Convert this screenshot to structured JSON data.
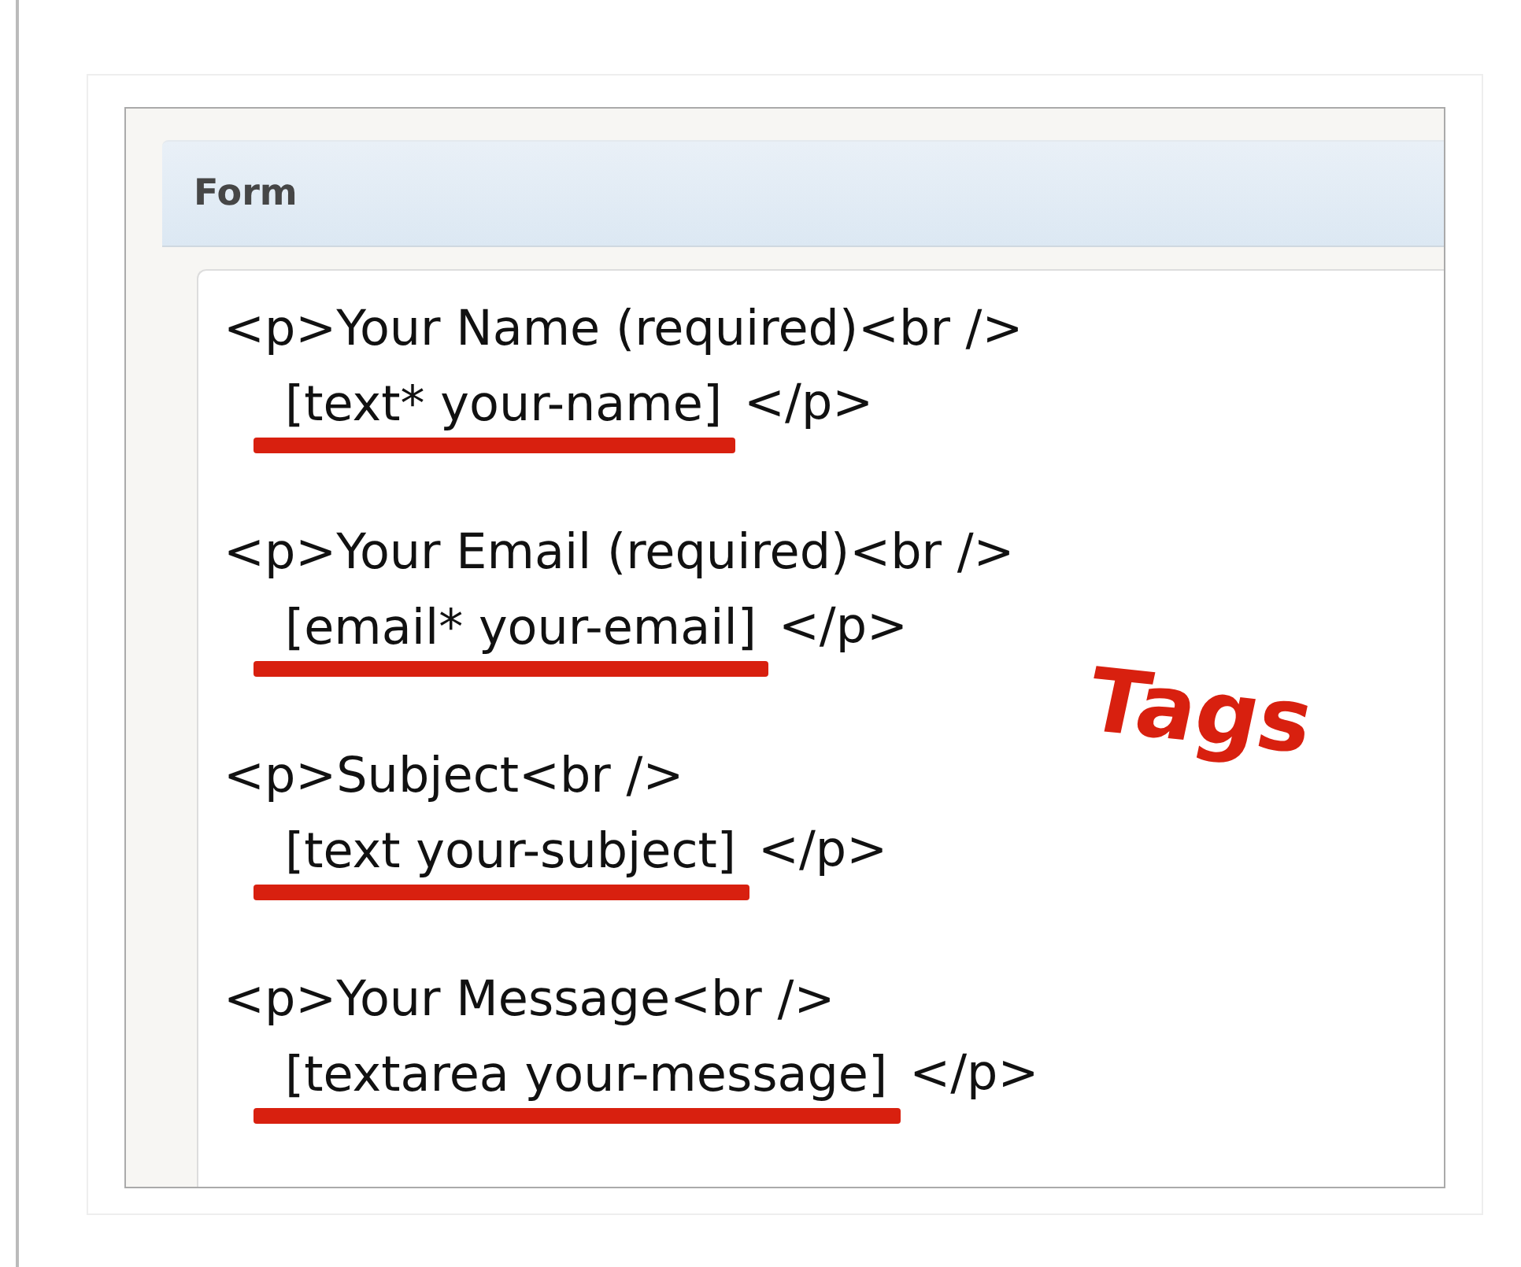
{
  "panel": {
    "title": "Form"
  },
  "blocks": [
    {
      "line": "<p>Your Name (required)<br />",
      "tag": "[text* your-name]",
      "close": "</p>"
    },
    {
      "line": "<p>Your Email (required)<br />",
      "tag": "[email* your-email]",
      "close": "</p>"
    },
    {
      "line": "<p>Subject<br />",
      "tag": "[text your-subject]",
      "close": "</p>"
    },
    {
      "line": "<p>Your Message<br />",
      "tag": "[textarea your-message]",
      "close": "</p>"
    }
  ],
  "annotation": "Tags"
}
